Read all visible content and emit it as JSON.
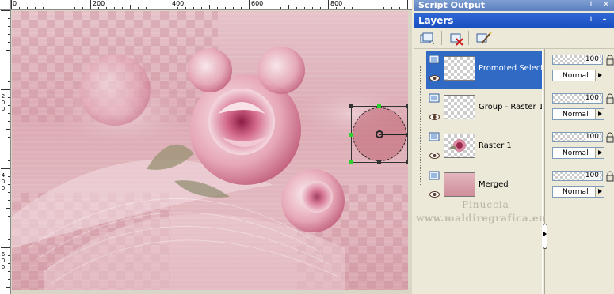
{
  "ruler": {
    "top_labels": [
      "0",
      "200",
      "400",
      "600",
      "800"
    ],
    "left_labels": [
      "2",
      "0",
      "0",
      "4",
      "0",
      "0",
      "6",
      "0",
      "0"
    ]
  },
  "script_output": {
    "title": "Script Output"
  },
  "layers_panel": {
    "title": "Layers",
    "toolbar": {
      "new_layer_icon": "new-layer-icon",
      "delete_layer_icon": "delete-layer-icon",
      "properties_icon": "layer-properties-icon"
    },
    "layers": [
      {
        "name": "Promoted Selection",
        "selected": true,
        "opacity": "100",
        "blend_mode": "Normal",
        "thumb": "transparent"
      },
      {
        "name": "Group - Raster 1",
        "selected": false,
        "opacity": "100",
        "blend_mode": "Normal",
        "thumb": "transparent"
      },
      {
        "name": "Raster 1",
        "selected": false,
        "opacity": "100",
        "blend_mode": "Normal",
        "thumb": "flower"
      },
      {
        "name": "Merged",
        "selected": false,
        "opacity": "100",
        "blend_mode": "Normal",
        "thumb": "pink"
      }
    ]
  },
  "watermark": {
    "line1": "Pinuccia",
    "line2": "www.maldiregrafica.eu"
  },
  "colors": {
    "selection": "#316ac5",
    "title_bar": "#2f66d4",
    "canvas_pink": "#e0b4bc"
  }
}
